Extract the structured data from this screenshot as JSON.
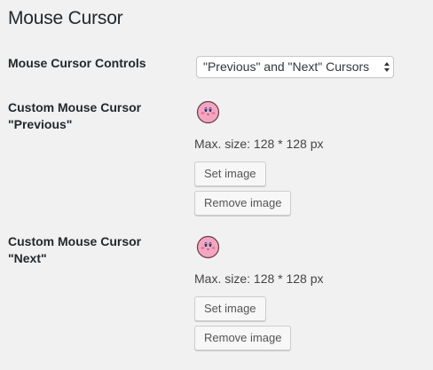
{
  "section": {
    "title": "Mouse Cursor"
  },
  "controls": {
    "label": "Mouse Cursor Controls",
    "selected_option": "\"Previous\" and \"Next\" Cursors"
  },
  "previous_cursor": {
    "label_line1": "Custom Mouse Cursor",
    "label_line2": "\"Previous\"",
    "size_note": "Max. size: 128 * 128 px",
    "set_button": "Set image",
    "remove_button": "Remove image",
    "image_icon": "kirby-face-icon"
  },
  "next_cursor": {
    "label_line1": "Custom Mouse Cursor",
    "label_line2": "\"Next\"",
    "size_note": "Max. size: 128 * 128 px",
    "set_button": "Set image",
    "remove_button": "Remove image",
    "image_icon": "kirby-face-icon"
  },
  "colors": {
    "background": "#f1f1f1",
    "avatar_pink": "#f4a6c1",
    "avatar_outline": "#6b3a4a",
    "button_bg": "#f7f7f7"
  }
}
